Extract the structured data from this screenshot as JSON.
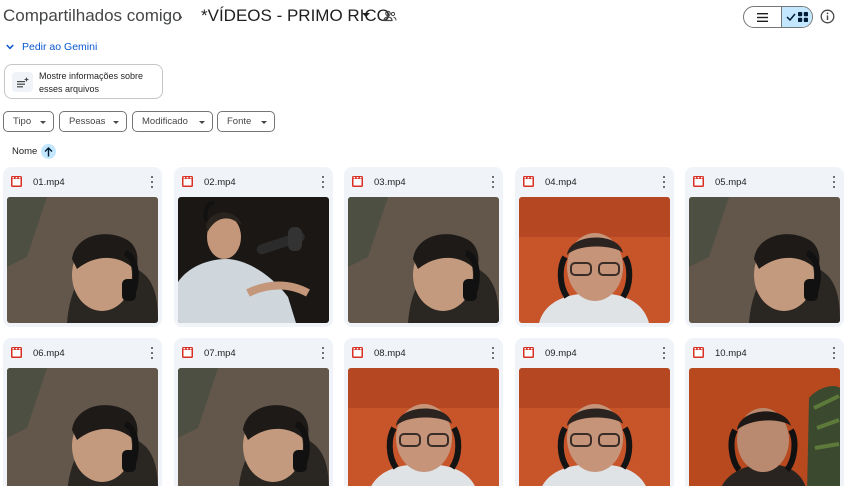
{
  "header": {
    "breadcrumb_root": "Compartilhados comigo",
    "breadcrumb_separator": "›",
    "current_folder": "*VÍDEOS - PRIMO RICO"
  },
  "gemini": {
    "label": "Pedir ao Gemini"
  },
  "suggestion": {
    "text": "Mostre informações sobre esses arquivos"
  },
  "filters": [
    "Tipo",
    "Pessoas",
    "Modificado",
    "Fonte"
  ],
  "sort": {
    "label": "Nome",
    "direction": "ascending"
  },
  "files": [
    {
      "name": "01.mp4",
      "thumb": "man-dark-bg"
    },
    {
      "name": "02.mp4",
      "thumb": "man-laughing-mic"
    },
    {
      "name": "03.mp4",
      "thumb": "man-dark-bg"
    },
    {
      "name": "04.mp4",
      "thumb": "man-glasses-orange"
    },
    {
      "name": "05.mp4",
      "thumb": "man-dark-bg"
    },
    {
      "name": "06.mp4",
      "thumb": "man-dark-bg"
    },
    {
      "name": "07.mp4",
      "thumb": "man-dark-bg"
    },
    {
      "name": "08.mp4",
      "thumb": "man-glasses-orange"
    },
    {
      "name": "09.mp4",
      "thumb": "man-glasses-orange"
    },
    {
      "name": "10.mp4",
      "thumb": "man-orange-plant"
    }
  ],
  "icons": {
    "file_type": "video-file-icon",
    "shared": "shared-people-icon",
    "list_view": "list-view-icon",
    "grid_view": "grid-view-icon",
    "info": "info-icon",
    "sort": "arrow-up-icon",
    "more": "more-vert-icon"
  },
  "colors": {
    "accent": "#0b57d0",
    "selected": "#c2e7ff",
    "card_bg": "#f0f4f9",
    "video_icon": "#d93025"
  }
}
